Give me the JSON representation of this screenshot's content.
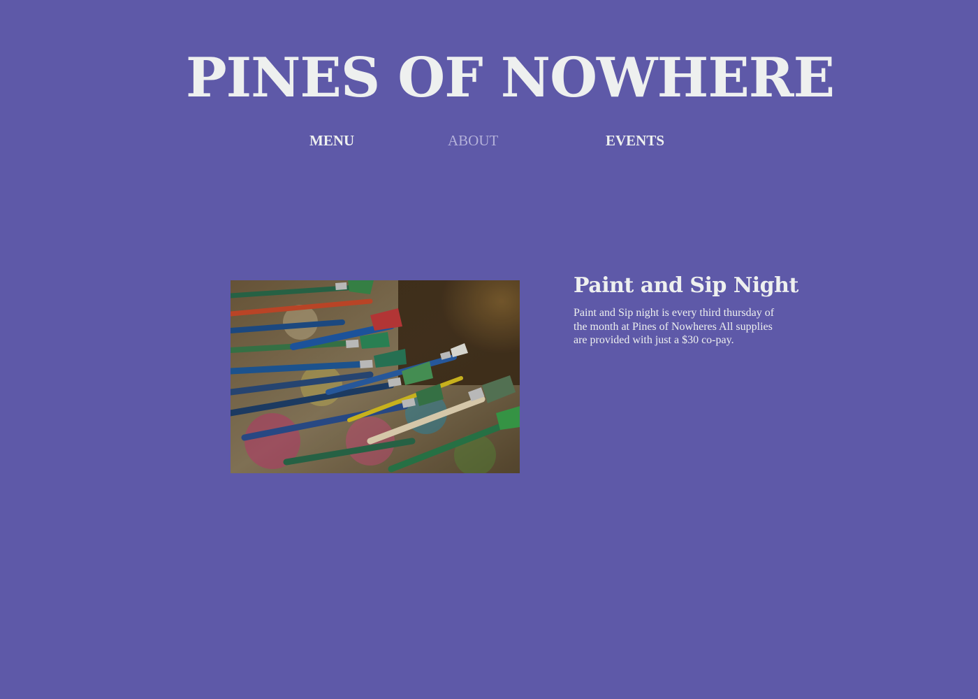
{
  "site": {
    "title": "PINES OF NOWHERE"
  },
  "nav": {
    "items": [
      {
        "label": "MENU"
      },
      {
        "label": "ABOUT",
        "active": true
      },
      {
        "label": "EVENTS"
      }
    ]
  },
  "event": {
    "title": "Paint and Sip Night",
    "description": "Paint and Sip night is every third thursday of the month at Pines of Nowheres All supplies are provided with just a $30 co-pay.",
    "image_icon": "paintbrushes-photo"
  },
  "colors": {
    "background": "#5e59a8",
    "text": "#eef0ef",
    "nav_active": "#b4b1da"
  }
}
